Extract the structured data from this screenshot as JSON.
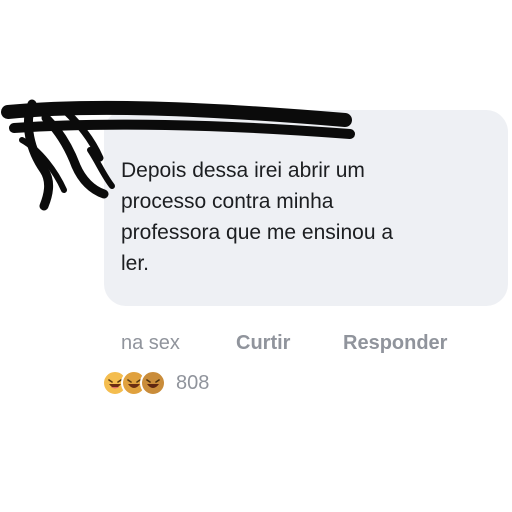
{
  "comment": {
    "author": "",
    "text": "Depois dessa irei abrir um\nprocesso contra minha\nprofessora que me ensinou a\nler."
  },
  "actions": {
    "time": "na sex",
    "like": "Curtir",
    "reply": "Responder"
  },
  "reactions": {
    "icons": [
      "laughing-emoji-icon",
      "laughing-emoji-icon",
      "laughing-emoji-icon"
    ],
    "count": "808"
  },
  "colors": {
    "bubble": "#eef0f4",
    "text": "#1c1e21",
    "meta": "#90949c",
    "redaction": "#0b0b0b",
    "emoji": "#f2b64b"
  }
}
